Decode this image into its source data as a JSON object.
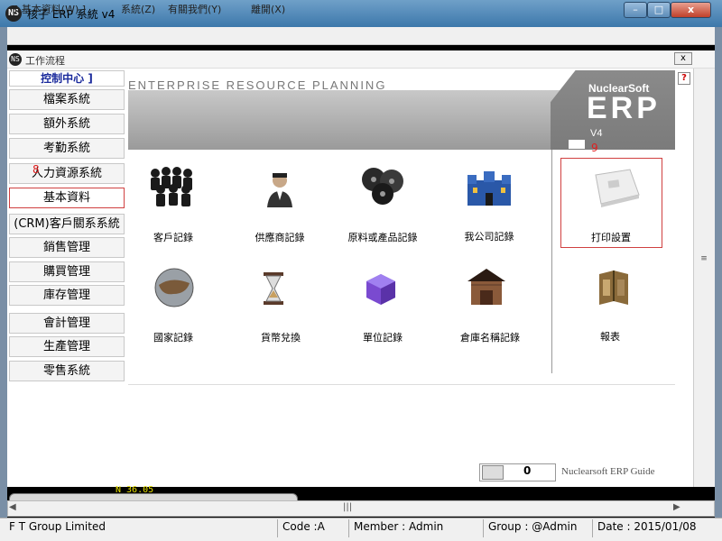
{
  "window": {
    "title": "核子 ERP 系統 v4",
    "logo": "NS",
    "min_label": "–",
    "max_label": "□",
    "close_label": "x"
  },
  "menu": [
    "[ 基本資料(W) ]",
    "系統(Z)",
    "有關我們(Y)",
    "離開(X)"
  ],
  "inner_window": {
    "title": "工作流程",
    "close_label": "x",
    "help_label": "?"
  },
  "sidebar": {
    "header": "控制中心 ]",
    "items": [
      "檔案系統",
      "額外系統",
      "考勤系統",
      "人力資源系統",
      "基本資料",
      "(CRM)客戶關系系統",
      "銷售管理",
      "購買管理",
      "庫存管理",
      "會計管理",
      "生產管理",
      "零售系統"
    ],
    "selected": "基本資料"
  },
  "banner": {
    "text": "ENTERPRISE RESOURCE PLANNING",
    "brand": "NuclearSoft",
    "product": "ERP",
    "version": "V4"
  },
  "items": [
    {
      "label": "客戶記錄",
      "icon": "people-group-icon"
    },
    {
      "label": "供應商記錄",
      "icon": "businessman-icon"
    },
    {
      "label": "原料或產品記錄",
      "icon": "film-reels-icon"
    },
    {
      "label": "我公司記錄",
      "icon": "castle-icon"
    },
    {
      "label": "打印設置",
      "icon": "printer-paper-icon"
    },
    {
      "label": "國家記錄",
      "icon": "globe-icon"
    },
    {
      "label": "貨幣兌換",
      "icon": "hourglass-icon"
    },
    {
      "label": "單位記錄",
      "icon": "cube-icon"
    },
    {
      "label": "倉庫名稱記錄",
      "icon": "warehouse-icon"
    },
    {
      "label": "報表",
      "icon": "report-book-icon"
    }
  ],
  "annotations": {
    "a8": "8",
    "a9": "9"
  },
  "guide": {
    "value": "0",
    "label": "Nuclearsoft ERP Guide"
  },
  "ticker": "N 36.05",
  "status": {
    "company": "F T Group Limited",
    "code": "Code :A",
    "member": "Member :  Admin",
    "group": "Group :  @Admin",
    "date": "Date :  2015/01/08"
  },
  "colors": {
    "accent_red": "#d04040",
    "header_blue": "#1a2a9c",
    "banner_gray": "#9a9a9a"
  }
}
